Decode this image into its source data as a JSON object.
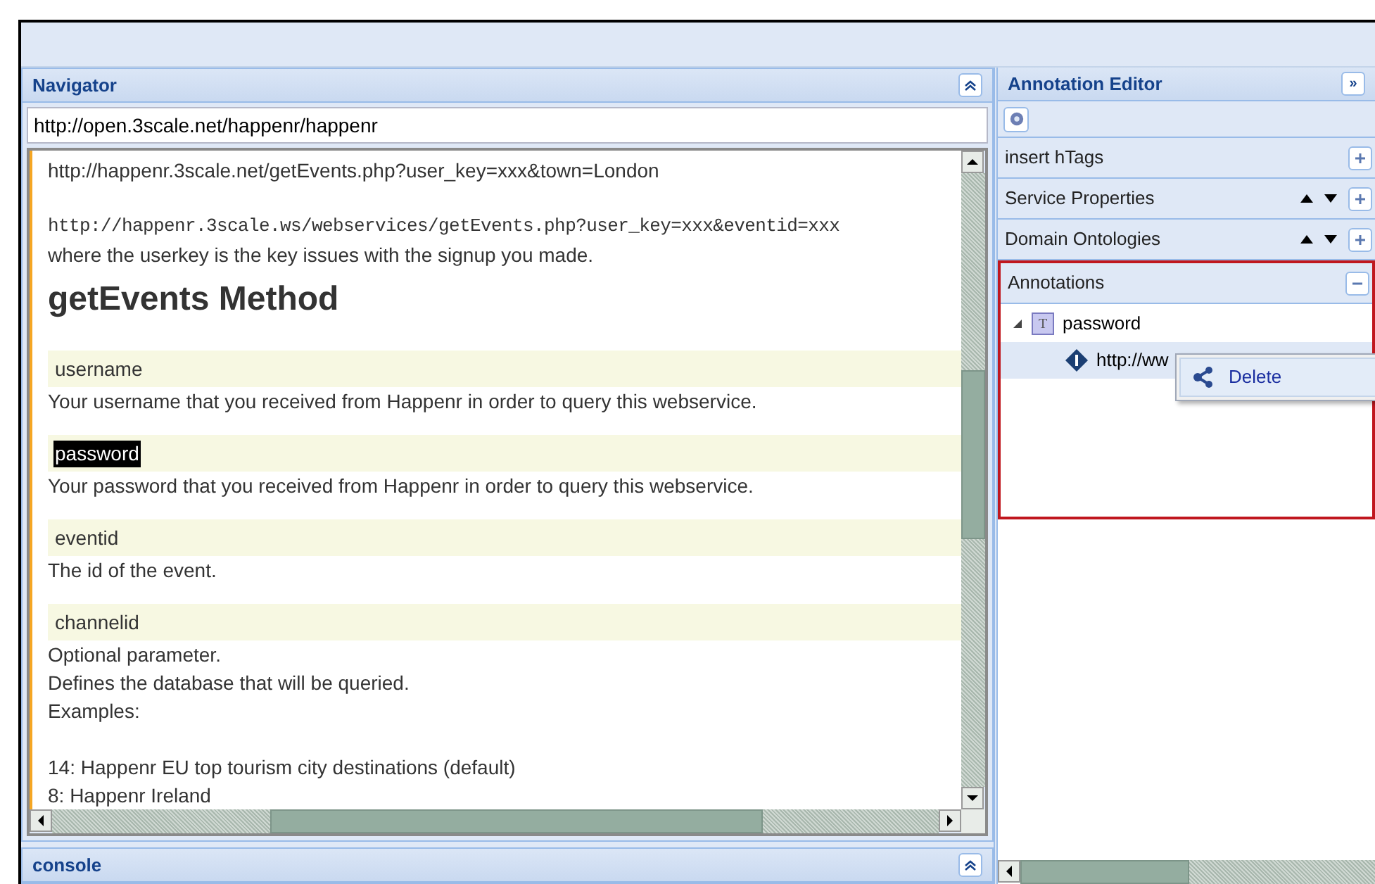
{
  "navigator": {
    "title": "Navigator",
    "url": "http://open.3scale.net/happenr/happenr",
    "content": [
      {
        "kind": "text",
        "text": "http://happenr.3scale.net/getEvents.php?user_key=xxx&town=London"
      },
      {
        "kind": "blank"
      },
      {
        "kind": "mono",
        "text": "http://happenr.3scale.ws/webservices/getEvents.php?user_key=xxx&eventid=xxx"
      },
      {
        "kind": "text",
        "text": "where the userkey is the key issues with the signup you made."
      },
      {
        "kind": "heading",
        "text": "getEvents Method"
      },
      {
        "kind": "param",
        "text": "username",
        "selected": false
      },
      {
        "kind": "text",
        "text": "Your username that you received from Happenr in order to query this webservice."
      },
      {
        "kind": "param",
        "text": "password",
        "selected": true
      },
      {
        "kind": "text",
        "text": "Your password that you received from Happenr in order to query this webservice."
      },
      {
        "kind": "param",
        "text": "eventid",
        "selected": false
      },
      {
        "kind": "text",
        "text": "The id of the event."
      },
      {
        "kind": "param",
        "text": "channelid",
        "selected": false
      },
      {
        "kind": "text",
        "text": "Optional parameter."
      },
      {
        "kind": "text",
        "text": "Defines the database that will be queried."
      },
      {
        "kind": "text",
        "text": "Examples:"
      },
      {
        "kind": "blank"
      },
      {
        "kind": "text",
        "text": "14: Happenr EU top tourism city destinations (default)"
      },
      {
        "kind": "text",
        "text": "8: Happenr Ireland"
      }
    ]
  },
  "console": {
    "title": "console"
  },
  "annotation_editor": {
    "title": "Annotation Editor",
    "collapse_glyph": "»",
    "sections": [
      {
        "title": "insert hTags",
        "expanded": false,
        "reorder": false
      },
      {
        "title": "Service Properties",
        "expanded": false,
        "reorder": true
      },
      {
        "title": "Domain Ontologies",
        "expanded": false,
        "reorder": true
      },
      {
        "title": "Annotations",
        "expanded": true,
        "reorder": false
      }
    ],
    "tree": [
      {
        "label": "password",
        "kind": "text",
        "type_letter": "T",
        "expanded": true,
        "selected": false,
        "children": [
          {
            "label": "http://ww",
            "kind": "uri",
            "selected": true
          }
        ]
      }
    ],
    "context_menu": {
      "items": [
        "Delete"
      ]
    }
  }
}
